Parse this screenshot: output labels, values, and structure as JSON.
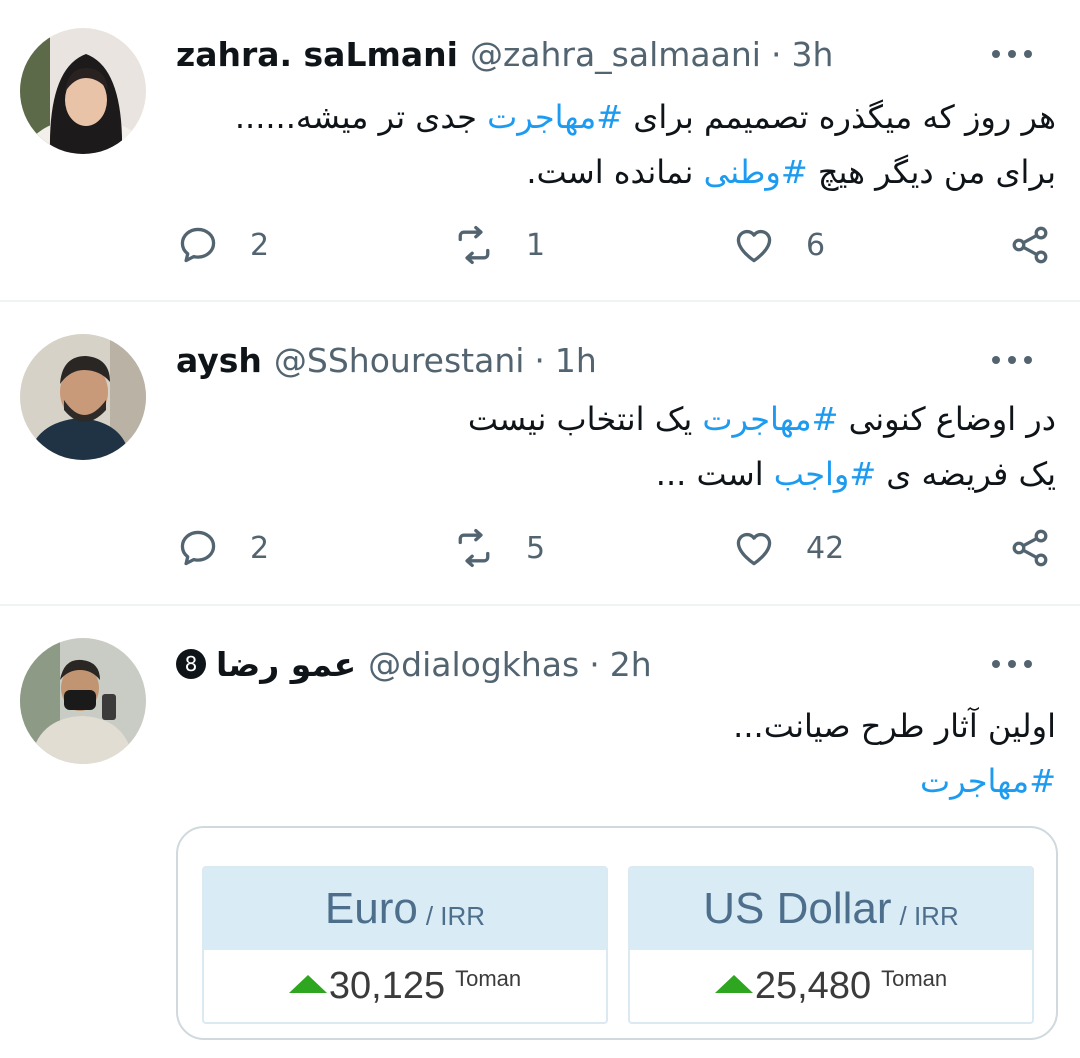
{
  "colors": {
    "accent": "#1d9bf0",
    "muted": "#536471",
    "up": "#2ea620",
    "fx_header": "#d9ebf5"
  },
  "tweets": [
    {
      "name": "zahra. saLmani",
      "handle": "@zahra_salmaani",
      "dot": "·",
      "time": "3h",
      "avatar": "profile-photo-woman-hijab",
      "lines": [
        {
          "pre": "هر روز که میگذره تصمیمم برای ",
          "tag": "#مهاجرت",
          "post": " جدی تر میشه......"
        },
        {
          "pre": "برای من دیگر هیچ ",
          "tag": "#وطنی",
          "post": " نمانده است."
        }
      ],
      "replies": "2",
      "retweets": "1",
      "likes": "6"
    },
    {
      "name": "aysh",
      "handle": "@SShourestani",
      "dot": "·",
      "time": "1h",
      "avatar": "profile-photo-man",
      "lines": [
        {
          "pre": "در اوضاع کنونی ",
          "tag": "#مهاجرت",
          "post": " یک انتخاب نیست"
        },
        {
          "pre": "یک فریضه ی ",
          "tag": "#واجب",
          "post": " است ..."
        }
      ],
      "replies": "2",
      "retweets": "5",
      "likes": "42"
    },
    {
      "name": "عمو رضا",
      "badge": "8",
      "handle": "@dialogkhas",
      "dot": "·",
      "time": "2h",
      "avatar": "profile-photo-man-mask",
      "lines": [
        {
          "pre": "اولین آثار طرح صیانت...",
          "tag": "",
          "post": ""
        },
        {
          "pre": "",
          "tag": "#مهاجرت",
          "post": ""
        }
      ]
    }
  ],
  "fx_card": [
    {
      "currency": "Euro",
      "unit": "/ IRR",
      "value": "30,125",
      "suffix": "Toman",
      "trend": "up"
    },
    {
      "currency": "US Dollar",
      "unit": "/ IRR",
      "value": "25,480",
      "suffix": "Toman",
      "trend": "up"
    }
  ]
}
